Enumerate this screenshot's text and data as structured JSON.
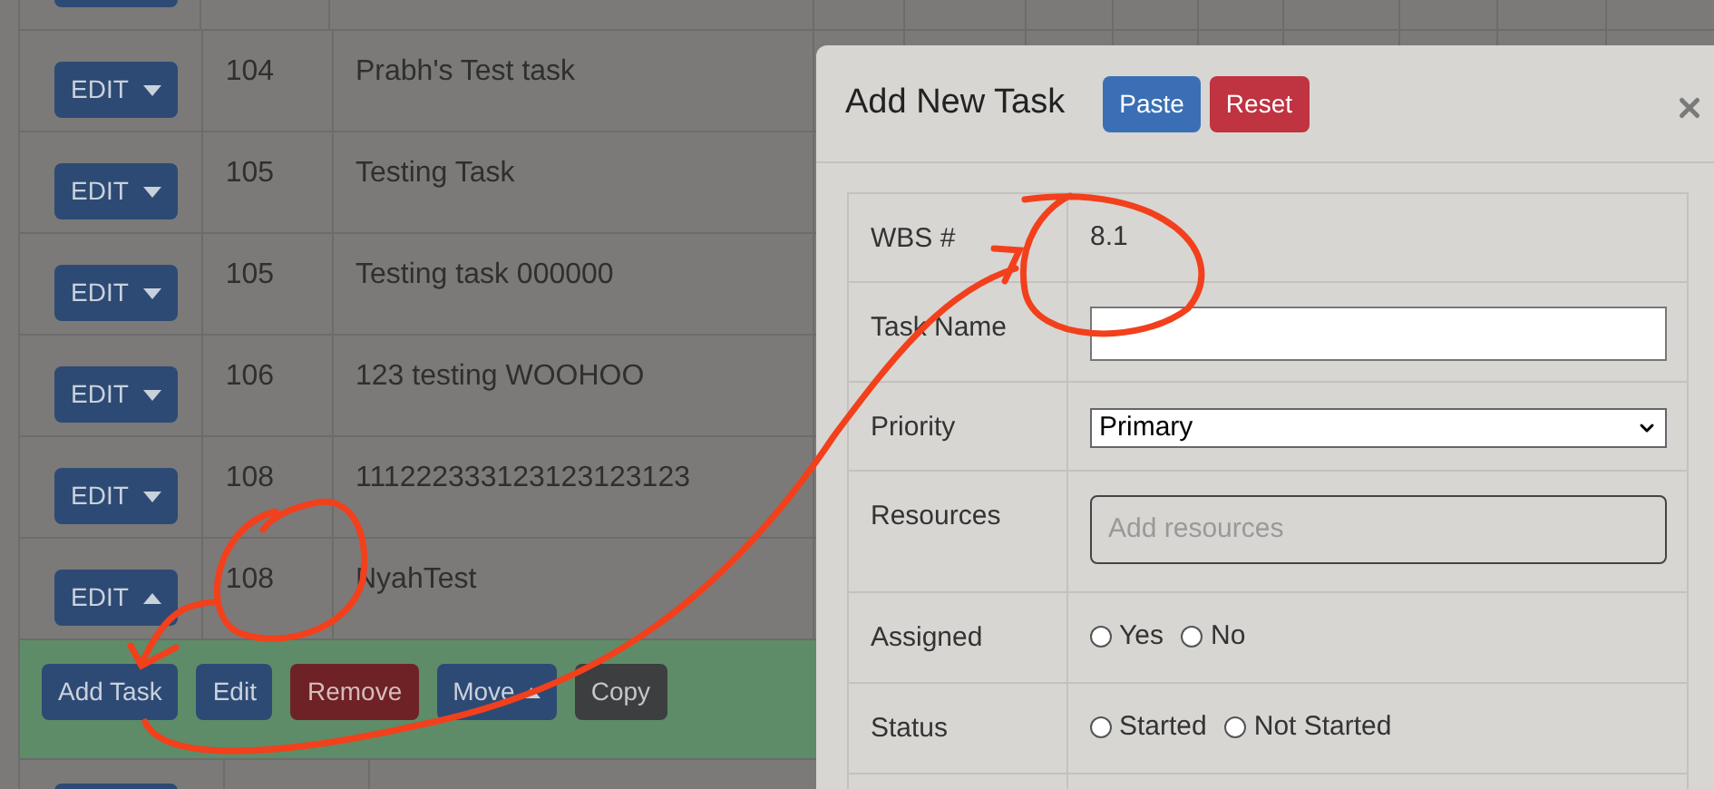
{
  "rows": [
    {
      "edit_label": "EDIT",
      "expanded": false,
      "id": "104",
      "name": "Prabh's Test task"
    },
    {
      "edit_label": "EDIT",
      "expanded": false,
      "id": "105",
      "name": "Testing Task"
    },
    {
      "edit_label": "EDIT",
      "expanded": false,
      "id": "105",
      "name": "Testing task 000000"
    },
    {
      "edit_label": "EDIT",
      "expanded": false,
      "id": "106",
      "name": "123 testing WOOHOO"
    },
    {
      "edit_label": "EDIT",
      "expanded": false,
      "id": "108",
      "name": "111222333123123123123"
    },
    {
      "edit_label": "EDIT",
      "expanded": true,
      "id": "108",
      "name": "NyahTest"
    }
  ],
  "action_bar": {
    "buttons": [
      {
        "label": "Add Task",
        "kind": "primary"
      },
      {
        "label": "Edit",
        "kind": "primary"
      },
      {
        "label": "Remove",
        "kind": "danger"
      },
      {
        "label": "Move",
        "kind": "dropdown"
      },
      {
        "label": "Copy",
        "kind": "secondary"
      }
    ]
  },
  "modal": {
    "title": "Add New Task",
    "buttons": [
      {
        "label": "Paste",
        "kind": "primary"
      },
      {
        "label": "Reset",
        "kind": "danger"
      }
    ],
    "fields": [
      {
        "label": "WBS #",
        "kind": "text",
        "value": "8.1"
      },
      {
        "label": "Task Name",
        "kind": "input"
      },
      {
        "label": "Priority",
        "kind": "select",
        "value": "Primary"
      },
      {
        "label": "Resources",
        "kind": "textarea",
        "placeholder": "Add resources"
      },
      {
        "label": "Assigned",
        "kind": "radio",
        "options": [
          {
            "label": "Yes",
            "selected": false
          },
          {
            "label": "No",
            "selected": false
          }
        ]
      },
      {
        "label": "Status",
        "kind": "radio",
        "options": [
          {
            "label": "Started",
            "selected": false
          },
          {
            "label": "Not Started",
            "selected": false
          }
        ]
      }
    ]
  }
}
